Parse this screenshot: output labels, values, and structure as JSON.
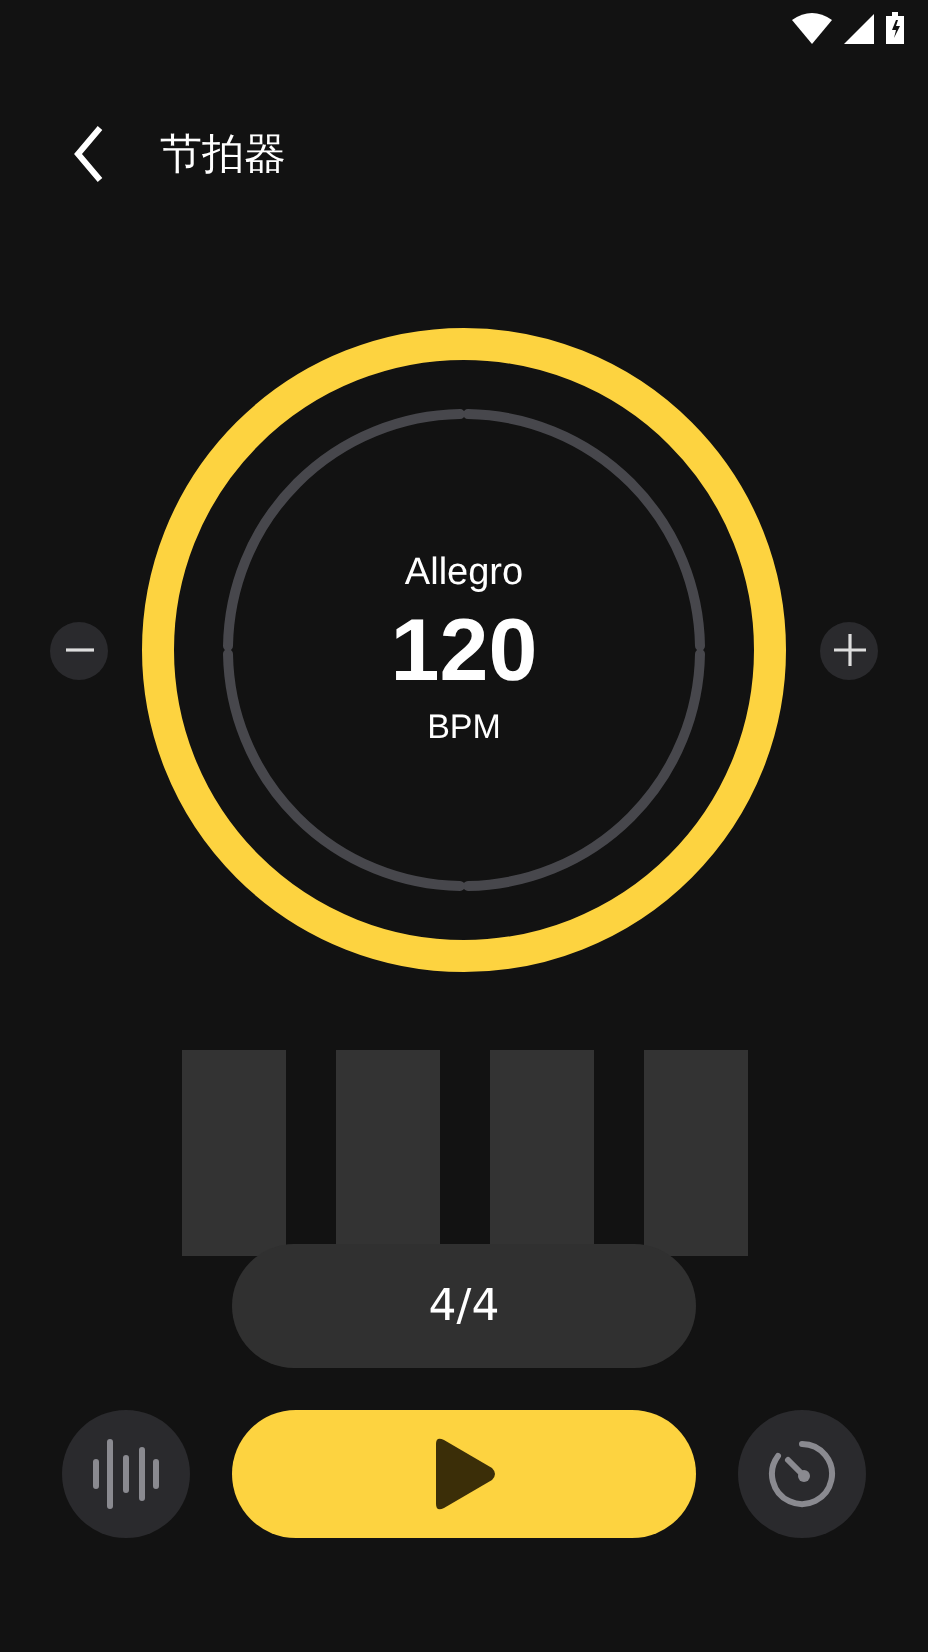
{
  "header": {
    "title": "节拍器"
  },
  "dial": {
    "tempo_name": "Allegro",
    "bpm": "120",
    "unit": "BPM"
  },
  "time_signature": "4/4"
}
